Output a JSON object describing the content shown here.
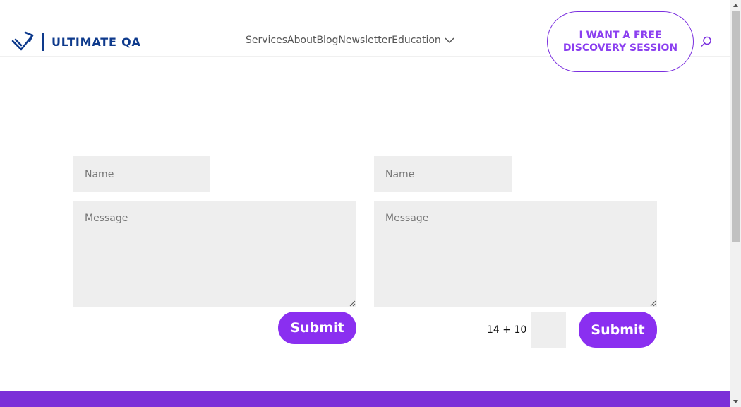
{
  "header": {
    "logo_text": "ULTIMATE QA",
    "nav": [
      "Services",
      "About",
      "Blog",
      "Newsletter",
      "Education"
    ],
    "cta_label": "I WANT A FREE DISCOVERY SESSION"
  },
  "form_left": {
    "name_placeholder": "Name",
    "message_placeholder": "Message",
    "submit_label": "Submit"
  },
  "form_right": {
    "name_placeholder": "Name",
    "message_placeholder": "Message",
    "captcha_question": "14 + 10 =",
    "captcha_value": "",
    "submit_label": "Submit"
  },
  "colors": {
    "brand_navy": "#0e3a8c",
    "accent_purple": "#8a2ff0",
    "field_bg": "#eeeeee"
  }
}
